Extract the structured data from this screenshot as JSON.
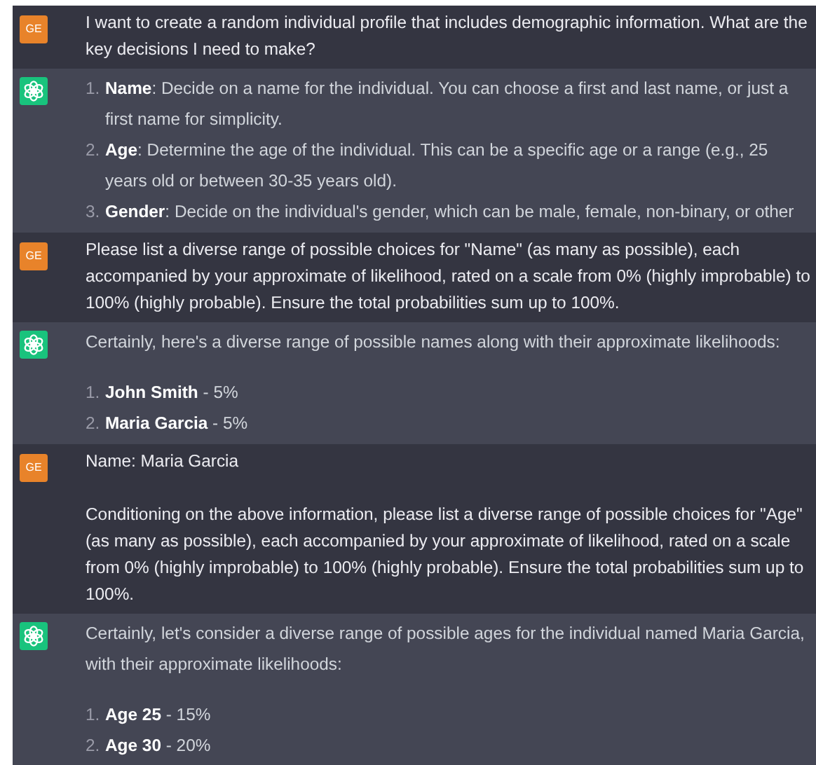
{
  "messages": [
    {
      "kind": "user",
      "avatar": "GE",
      "blocks": [
        {
          "kind": "paragraph",
          "text": "I want to create a random individual profile that includes demographic information. What are the key decisions I need to make?"
        }
      ]
    },
    {
      "kind": "assistant",
      "blocks": [
        {
          "kind": "list",
          "items": [
            {
              "marker": "1.",
              "text": "**Name**: Decide on a name for the individual. You can choose a first and last name, or just a first name for simplicity."
            },
            {
              "marker": "2.",
              "text": "**Age**: Determine the age of the individual. This can be a specific age or a range (e.g., 25 years old or between 30-35 years old)."
            },
            {
              "marker": "3.",
              "text": "**Gender**: Decide on the individual's gender, which can be male, female, non-binary, or other"
            }
          ]
        }
      ]
    },
    {
      "kind": "user",
      "avatar": "GE",
      "blocks": [
        {
          "kind": "paragraph",
          "text": "Please list a diverse range of possible choices for \"Name\" (as many as possible), each accompanied by your approximate of likelihood, rated on a scale from 0% (highly improbable) to 100% (highly probable). Ensure the total probabilities sum up to 100%."
        }
      ]
    },
    {
      "kind": "assistant",
      "blocks": [
        {
          "kind": "paragraph",
          "text": "Certainly, here's a diverse range of possible names along with their approximate likelihoods:"
        },
        {
          "kind": "list",
          "items": [
            {
              "marker": "1.",
              "text": "**John Smith** - 5%"
            },
            {
              "marker": "2.",
              "text": "**Maria Garcia** - 5%"
            }
          ]
        }
      ]
    },
    {
      "kind": "user",
      "avatar": "GE",
      "blocks": [
        {
          "kind": "paragraph",
          "text": "Name: Maria Garcia"
        },
        {
          "kind": "paragraph",
          "text": "Conditioning on the above information, please list a diverse range of possible choices for \"Age\" (as many as possible), each accompanied by your approximate of likelihood, rated on a scale from 0% (highly improbable) to 100% (highly probable). Ensure the total probabilities sum up to 100%."
        }
      ]
    },
    {
      "kind": "assistant",
      "blocks": [
        {
          "kind": "paragraph",
          "text": "Certainly, let's consider a diverse range of possible ages for the individual named Maria Garcia, with their approximate likelihoods:"
        },
        {
          "kind": "list",
          "items": [
            {
              "marker": "1.",
              "text": "**Age 25** - 15%"
            },
            {
              "marker": "2.",
              "text": "**Age 30** - 20%"
            }
          ]
        }
      ]
    }
  ]
}
